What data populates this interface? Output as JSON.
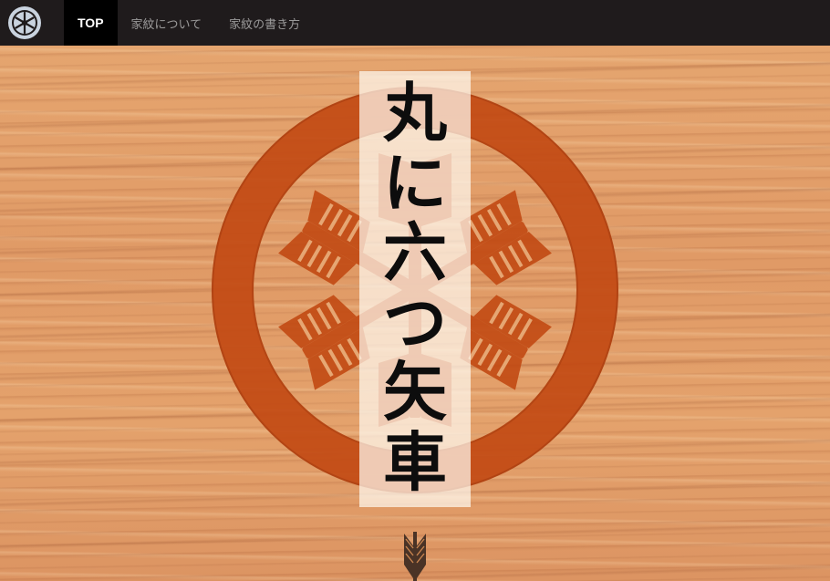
{
  "nav": {
    "logo_icon": "kamon-logo-icon",
    "items": [
      {
        "label": "TOP",
        "active": true
      },
      {
        "label": "家紋について",
        "active": false
      },
      {
        "label": "家紋の書き方",
        "active": false
      }
    ]
  },
  "hero": {
    "title": "丸に六つ矢車",
    "title_chars": [
      "丸",
      "に",
      "六",
      "つ",
      "矢",
      "車"
    ],
    "crest_icon": "maru-ni-mutsu-yaguruma-crest",
    "scroll_icon": "arrow-down-icon"
  },
  "colors": {
    "nav_bg": "#1f1b1c",
    "nav_active_bg": "#000000",
    "nav_text": "#9b9a9a",
    "wood": "#e3a06a",
    "crest_red": "#c04a12",
    "title_text": "#0d0d0d"
  }
}
